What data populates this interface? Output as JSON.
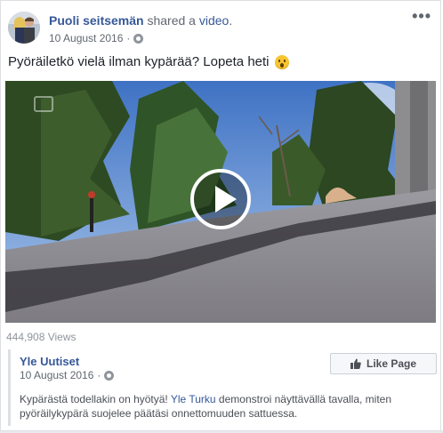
{
  "post": {
    "author": "Puoli seitsemän",
    "action": "shared a",
    "object": "video",
    "object_suffix": ".",
    "date": "10 August 2016",
    "privacy_icon": "globe-icon",
    "more_label": "•••",
    "text": "Pyöräiletkö vielä ilman kypärää? Lopeta heti",
    "emoji": "surprised-face-emoji"
  },
  "video": {
    "views": "444,908 Views",
    "play_icon": "play-icon"
  },
  "shared_page": {
    "name": "Yle Uutiset",
    "date": "10 August 2016",
    "like_button": "Like Page",
    "description_before": "Kypärästä todellakin on hyötyä! ",
    "description_link": "Yle Turku",
    "description_after": " demonstroi näyttävällä tavalla, miten pyöräilykypärä suojelee päätäsi onnettomuuden sattuessa."
  }
}
